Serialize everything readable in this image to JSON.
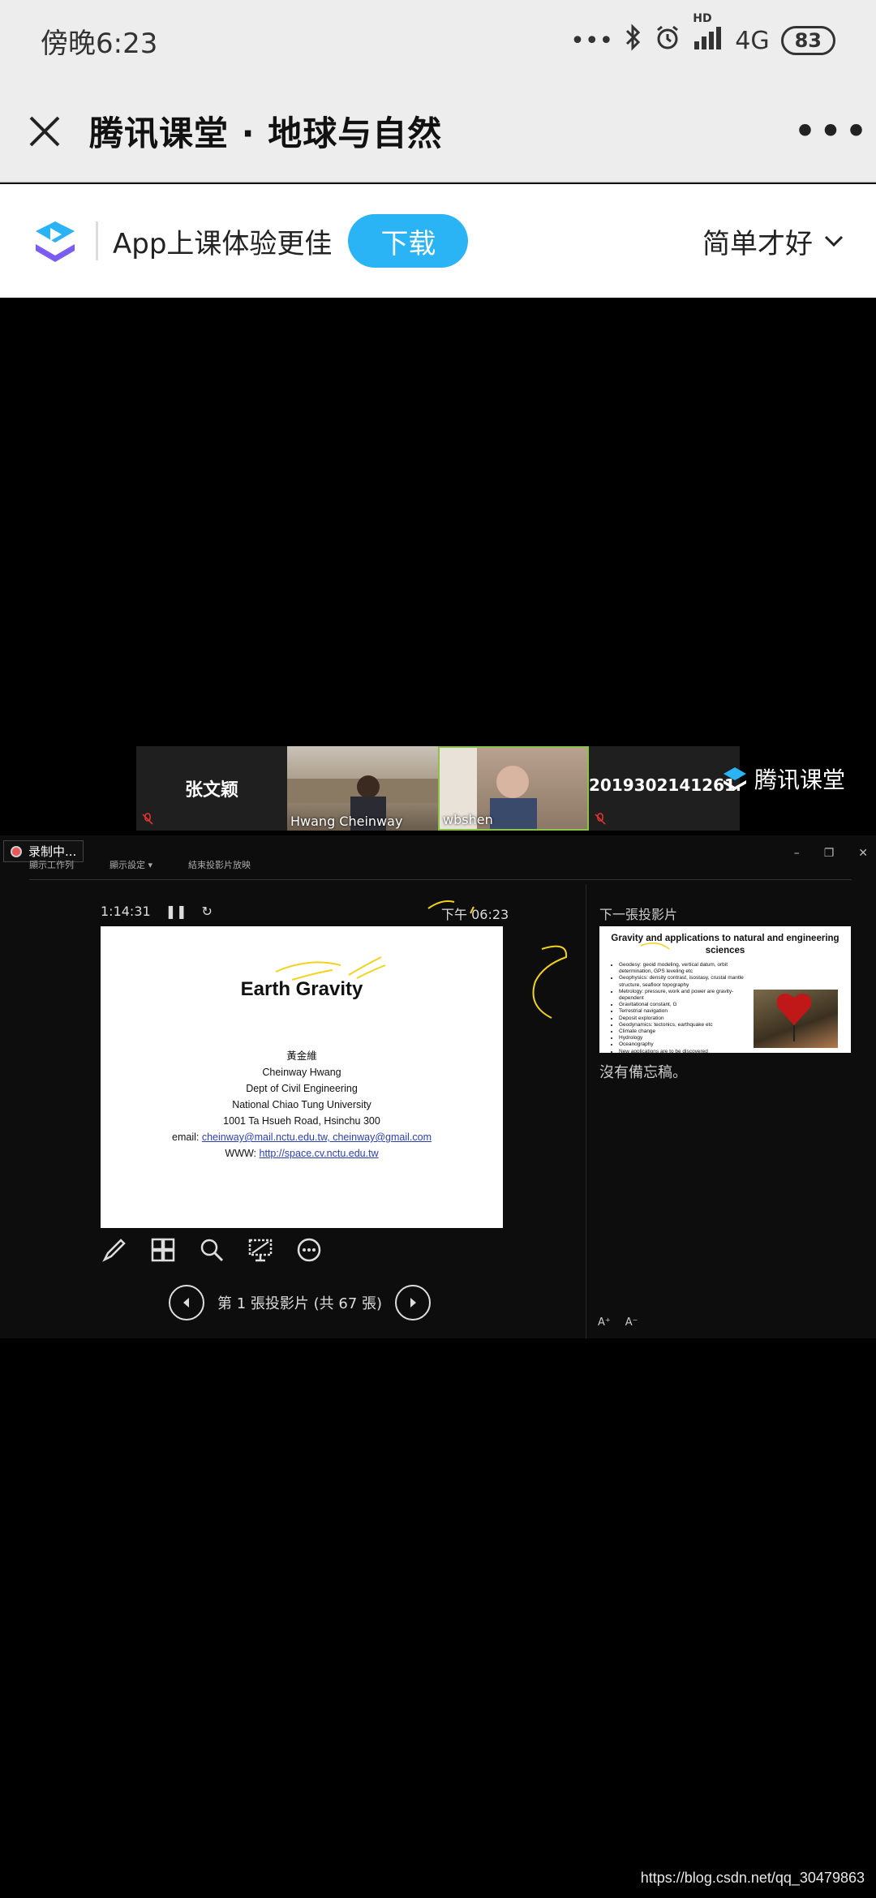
{
  "status_bar": {
    "time": "傍晚6:23",
    "network": "4G",
    "hd": "HD",
    "battery": "83"
  },
  "title_bar": {
    "title": "腾讯课堂 · 地球与自然"
  },
  "banner": {
    "text": "App上课体验更佳",
    "download": "下载",
    "user": "简单才好"
  },
  "participants": [
    {
      "name": "张文颖",
      "type": "avatar"
    },
    {
      "name": "Hwang Cheinway",
      "type": "camera"
    },
    {
      "name": "wbshen",
      "type": "camera"
    },
    {
      "name": "2019302141261...",
      "type": "avatar"
    }
  ],
  "brand": "腾讯课堂",
  "presenter": {
    "recording": "录制中...",
    "toolbar": [
      "顯示工作列",
      "顯示設定 ▾",
      "結束投影片放映"
    ],
    "elapsed": "1:14:31",
    "clock": "下午 06:23",
    "slide": {
      "title": "Earth Gravity",
      "author_cn": "黃金維",
      "author": "Cheinway Hwang",
      "dept": "Dept of Civil Engineering",
      "univ": "National Chiao Tung University",
      "address": "1001 Ta Hsueh Road, Hsinchu 300",
      "email_label": "email:",
      "emails": "cheinway@mail.nctu.edu.tw, cheinway@gmail.com",
      "www_label": "WWW:",
      "www": "http://space.cv.nctu.edu.tw"
    },
    "slide_counter": "第 1 張投影片 (共 67 張)",
    "next_label": "下一張投影片",
    "next_slide": {
      "title": "Gravity and applications to natural and engineering sciences",
      "bullets": [
        "Geodesy: geoid modeling, vertical datum, orbit determination, GPS leveling etc",
        "Geophysics: density contrast, isostasy, crustal mantle structure, seafloor topography",
        "Metrology: pressure, work and power are gravity-dependent",
        "Gravitational constant, G",
        "Terrestrial navigation",
        "Deposit exploration",
        "Geodynamics: tectonics, earthquake etc",
        "Climate change",
        "Hydrology",
        "Oceanography",
        "New applications are to be discovered"
      ]
    },
    "notes": "沒有備忘稿。",
    "font_buttons": [
      "A⁺",
      "A⁻"
    ]
  },
  "footer_url": "https://blog.csdn.net/qq_30479863"
}
